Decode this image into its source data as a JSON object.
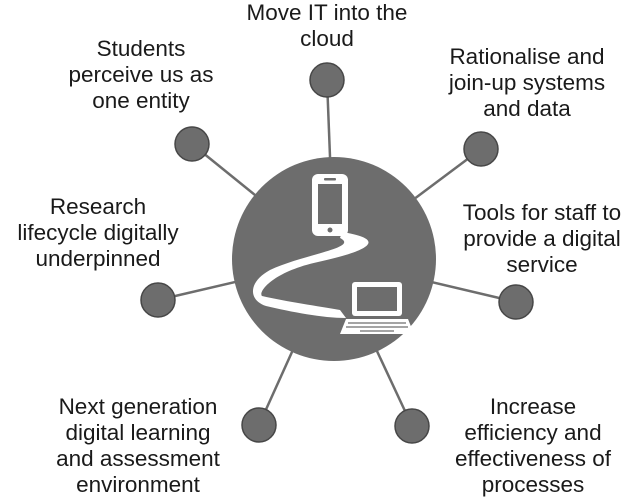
{
  "hub": {
    "icons": [
      "smartphone-icon",
      "winding-road-icon",
      "laptop-icon"
    ],
    "colors": {
      "hub": "#6d6d6d",
      "node": "#6d6d6d",
      "spoke": "#6d6d6d",
      "icon": "#ffffff",
      "text": "#1a1a1a"
    }
  },
  "nodes": [
    {
      "id": "move-it-cloud",
      "lines": [
        "Move IT into the",
        "cloud"
      ]
    },
    {
      "id": "rationalise-systems",
      "lines": [
        "Rationalise and",
        "join-up systems",
        "and data"
      ]
    },
    {
      "id": "tools-for-staff",
      "lines": [
        "Tools for staff to",
        "provide a digital",
        "service"
      ]
    },
    {
      "id": "increase-efficiency",
      "lines": [
        "Increase",
        "efficiency and",
        "effectiveness of",
        "processes"
      ]
    },
    {
      "id": "next-gen-learning",
      "lines": [
        "Next generation",
        "digital learning",
        "and assessment",
        "environment"
      ]
    },
    {
      "id": "research-lifecycle",
      "lines": [
        "Research",
        "lifecycle digitally",
        "underpinned"
      ]
    },
    {
      "id": "students-one-entity",
      "lines": [
        "Students",
        "perceive us as",
        "one entity"
      ]
    }
  ]
}
